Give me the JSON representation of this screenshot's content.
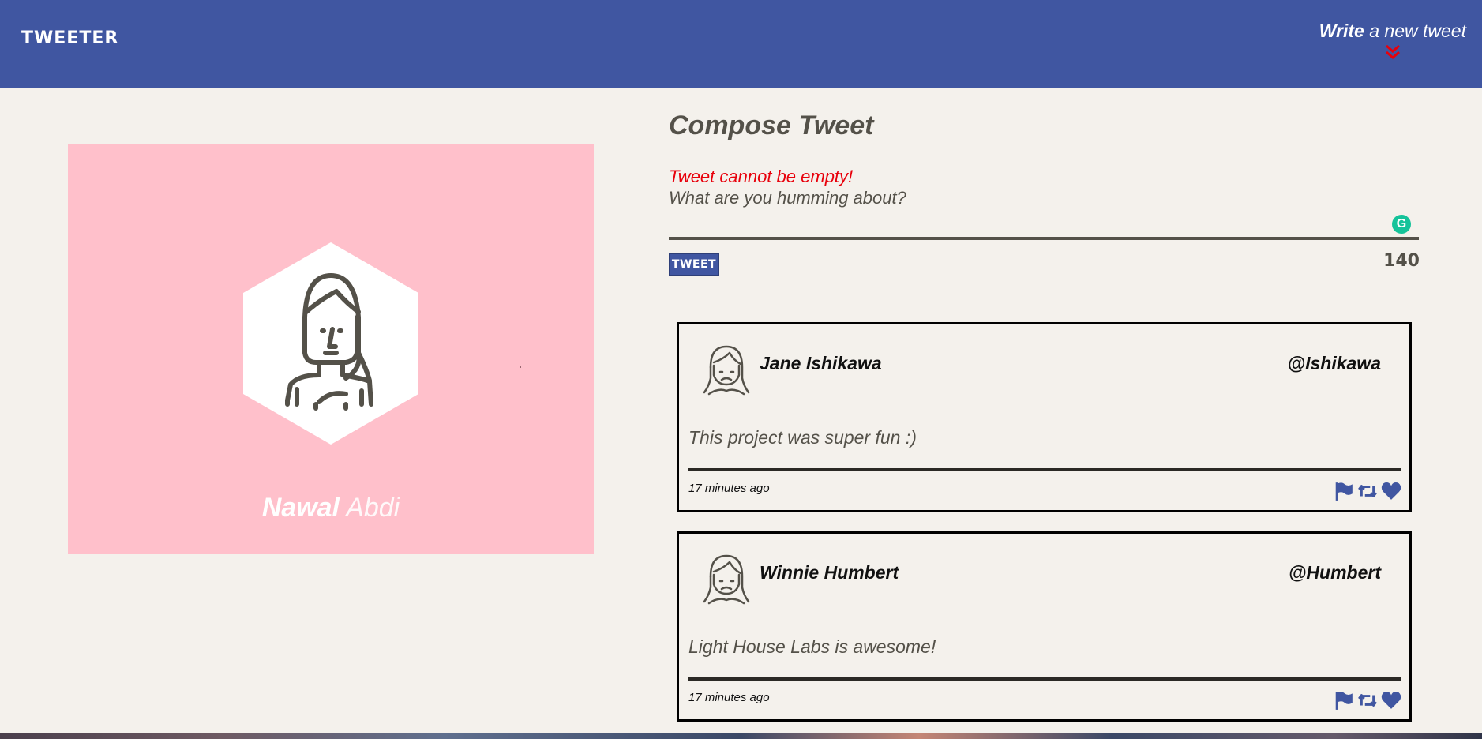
{
  "header": {
    "brand": "TWEETER",
    "write_bold": "Write",
    "write_rest": "a new tweet",
    "write_icon": "double-chevron-down-icon",
    "chevron_color": "#e8000b"
  },
  "profile": {
    "first_name": "Nawal",
    "last_name": "Abdi",
    "background": "#ffc0cb"
  },
  "compose": {
    "title": "Compose Tweet",
    "error": "Tweet cannot be empty!",
    "placeholder": "What are you humming about?",
    "button_label": "TWEET",
    "counter": "140"
  },
  "tweets": [
    {
      "name": "Jane Ishikawa",
      "handle": "@Ishikawa",
      "content": "This project was super fun :)",
      "time": "17 minutes ago"
    },
    {
      "name": "Winnie Humbert",
      "handle": "@Humbert",
      "content": "Light House Labs is awesome!",
      "time": "17 minutes ago"
    }
  ],
  "icons": {
    "flag": "flag-icon",
    "retweet": "retweet-icon",
    "like": "heart-icon",
    "accent": "#4056a1"
  }
}
